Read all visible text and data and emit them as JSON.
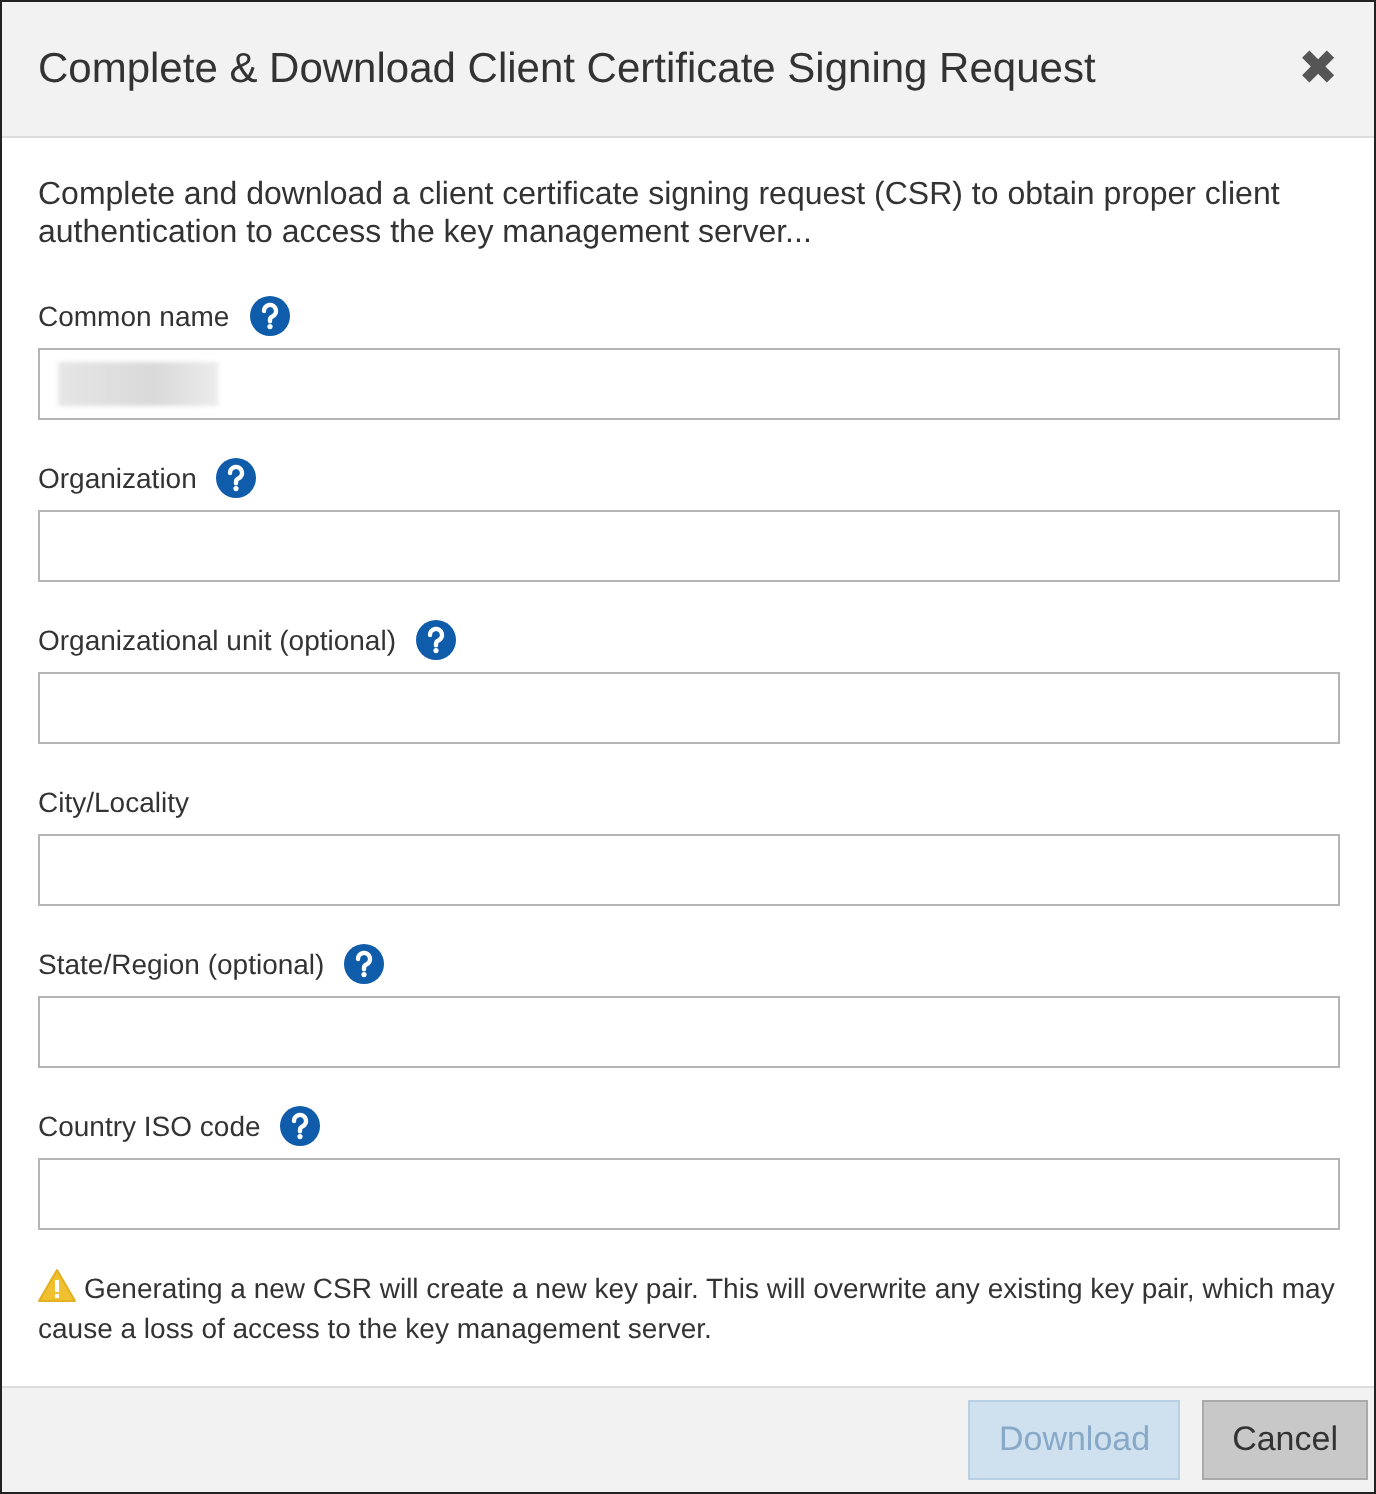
{
  "dialog": {
    "title": "Complete & Download Client Certificate Signing Request",
    "close": "✖"
  },
  "description": "Complete and download a client certificate signing request (CSR) to obtain proper client authentication to access the key management server...",
  "fields": [
    {
      "label": "Common name",
      "help": true,
      "redacted": true
    },
    {
      "label": "Organization",
      "help": true,
      "redacted": false
    },
    {
      "label": "Organizational unit (optional)",
      "help": true,
      "redacted": false
    },
    {
      "label": "City/Locality",
      "help": false,
      "redacted": false
    },
    {
      "label": "State/Region (optional)",
      "help": true,
      "redacted": false
    },
    {
      "label": "Country ISO code",
      "help": true,
      "redacted": false
    }
  ],
  "warning": "Generating a new CSR will create a new key pair. This will overwrite any existing key pair, which may cause a loss of access to the key management server.",
  "buttons": [
    {
      "label": "Download",
      "kind": "primary",
      "disabled": true
    },
    {
      "label": "Cancel",
      "kind": "secondary",
      "disabled": false
    }
  ]
}
